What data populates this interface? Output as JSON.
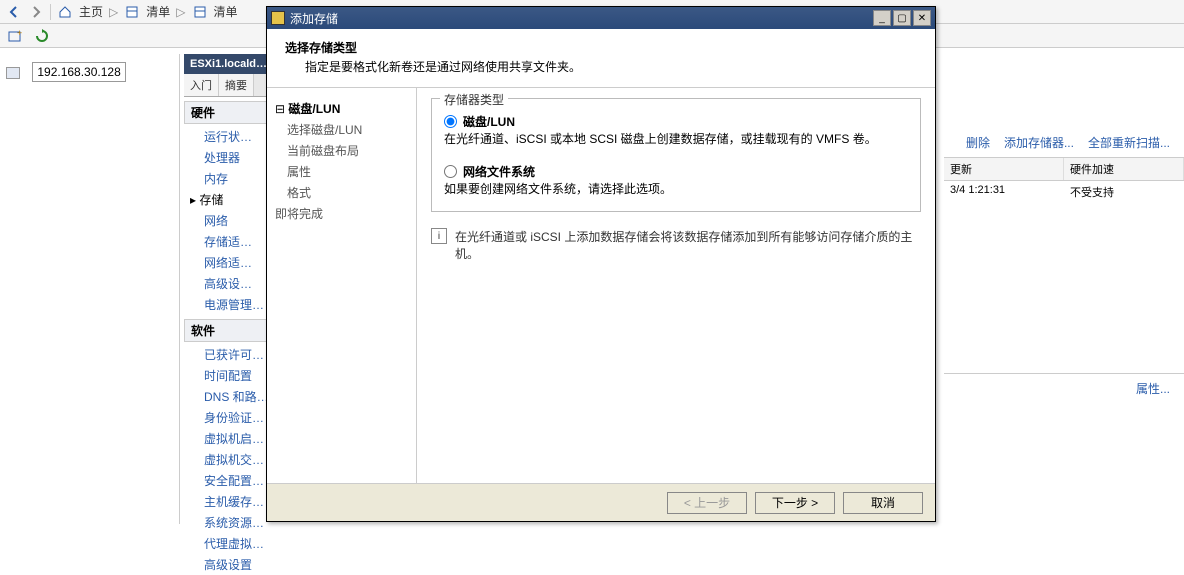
{
  "toolbar": {
    "home": "主页",
    "list1": "清单",
    "list2": "清单"
  },
  "left": {
    "ip": "192.168.30.128"
  },
  "mid": {
    "host": "ESXi1.locald…",
    "tabs": [
      "入门",
      "摘要"
    ],
    "hw_header": "硬件",
    "hw_items": [
      "运行状…",
      "处理器",
      "内存",
      "存储",
      "网络",
      "存储适…",
      "网络适…",
      "高级设…",
      "电源管理…"
    ],
    "sw_header": "软件",
    "sw_items": [
      "已获许可…",
      "时间配置",
      "DNS 和路…",
      "身份验证…",
      "虚拟机启…",
      "虚拟机交…",
      "安全配置…",
      "主机缓存…",
      "系统资源…",
      "代理虚拟…",
      "高级设置"
    ]
  },
  "right": {
    "links": {
      "del": "删除",
      "add": "添加存储器...",
      "rescan": "全部重新扫描..."
    },
    "cols": {
      "upd": "更新",
      "accel": "硬件加速"
    },
    "row": {
      "upd": "3/4 1:21:31",
      "accel": "不受支持"
    },
    "prop": "属性..."
  },
  "dialog": {
    "title": "添加存储",
    "header": {
      "t1": "选择存储类型",
      "t2": "指定是要格式化新卷还是通过网络使用共享文件夹。"
    },
    "nav": {
      "step1": "磁盘/LUN",
      "step1a": "选择磁盘/LUN",
      "step1b": "当前磁盘布局",
      "step1c": "属性",
      "step1d": "格式",
      "step2": "即将完成"
    },
    "group_title": "存储器类型",
    "opt1": {
      "label": "磁盘/LUN",
      "desc": "在光纤通道、iSCSI 或本地 SCSI 磁盘上创建数据存储，或挂载现有的 VMFS 卷。"
    },
    "opt2": {
      "label": "网络文件系统",
      "desc": "如果要创建网络文件系统，请选择此选项。"
    },
    "hint": "在光纤通道或 iSCSI 上添加数据存储会将该数据存储添加到所有能够访问存储介质的主机。",
    "buttons": {
      "back": "< 上一步",
      "next": "下一步 >",
      "cancel": "取消"
    }
  }
}
